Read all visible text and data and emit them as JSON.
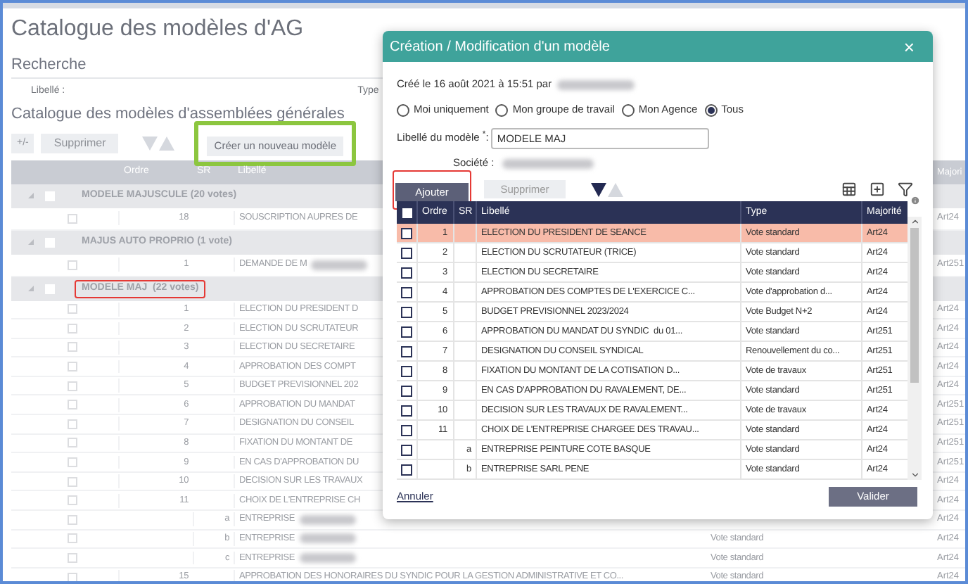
{
  "page": {
    "title": "Catalogue des modèles d'AG",
    "search_heading": "Recherche",
    "search_label": "Libellé :",
    "type_label": "Type",
    "catalog_heading": "Catalogue des modèles d'assemblées générales"
  },
  "toolbar": {
    "toggle": "+/-",
    "delete": "Supprimer",
    "create": {
      "label": "Créer un nouveau modèle",
      "annotated": true
    }
  },
  "catalog": {
    "columns": [
      "Ordre",
      "SR",
      "Libellé",
      "Majori"
    ],
    "groups": [
      {
        "label": "MODELE MAJUSCULE (20 votes)",
        "annotated": false,
        "checked": false,
        "rows": [
          {
            "ordre": "18",
            "libelle": "SOUSCRIPTION AUPRES DE",
            "majorite": "Art24",
            "checked": false
          }
        ]
      },
      {
        "label": "MAJUS AUTO PROPRIO (1 vote)",
        "annotated": false,
        "checked": false,
        "rows": [
          {
            "ordre": "1",
            "libelle": "DEMANDE DE M",
            "redacted": true,
            "majorite": "Art251",
            "checked": false
          }
        ]
      },
      {
        "label": "MODELE MAJ  (22 votes)",
        "annotated": true,
        "checked": false,
        "rows": [
          {
            "ordre": "1",
            "libelle": "ELECTION DU PRESIDENT D",
            "majorite": "Art24",
            "checked": false
          },
          {
            "ordre": "2",
            "libelle": "ELECTION DU SCRUTATEUR",
            "majorite": "Art24",
            "checked": false
          },
          {
            "ordre": "3",
            "libelle": "ELECTION DU SECRETAIRE",
            "majorite": "Art24",
            "checked": false
          },
          {
            "ordre": "4",
            "libelle": "APPROBATION DES COMPT",
            "majorite": "Art24",
            "checked": false
          },
          {
            "ordre": "5",
            "libelle": "BUDGET PREVISIONNEL 202",
            "majorite": "Art24",
            "checked": false
          },
          {
            "ordre": "6",
            "libelle": "APPROBATION DU MANDAT",
            "majorite": "Art251",
            "checked": false
          },
          {
            "ordre": "7",
            "libelle": "DESIGNATION DU CONSEIL",
            "majorite": "Art251",
            "checked": false
          },
          {
            "ordre": "8",
            "libelle": "FIXATION DU MONTANT DE",
            "majorite": "Art251",
            "checked": false
          },
          {
            "ordre": "9",
            "libelle": "EN CAS D'APPROBATION DU",
            "majorite": "Art251",
            "checked": false
          },
          {
            "ordre": "10",
            "libelle": "DECISION SUR LES TRAVAUX",
            "majorite": "Art24",
            "checked": false
          },
          {
            "ordre": "11",
            "libelle": "CHOIX DE L'ENTREPRISE CH",
            "majorite": "Art24",
            "checked": false
          },
          {
            "sr": "a",
            "libelle": "ENTREPRISE",
            "redacted": true,
            "majorite": "Art24",
            "checked": false
          },
          {
            "sr": "b",
            "libelle": "ENTREPRISE",
            "redacted": true,
            "type": "Vote standard",
            "majorite": "Art24",
            "checked": false
          },
          {
            "sr": "c",
            "libelle": "ENTREPRISE",
            "redacted": true,
            "type": "Vote standard",
            "majorite": "Art24",
            "checked": false
          },
          {
            "ordre": "15",
            "libelle": "APPROBATION DES HONORAIRES DU SYNDIC POUR LA GESTION ADMINISTRATIVE ET CO...",
            "type": "Vote standard",
            "majorite": "Art24",
            "checked": false
          }
        ]
      }
    ]
  },
  "dialog": {
    "title": "Création / Modification d'un modèle",
    "close": "×",
    "created": "Créé le 16 août 2021 à 15:51 par",
    "visibility": [
      {
        "label": "Moi uniquement",
        "selected": false
      },
      {
        "label": "Mon groupe de travail",
        "selected": false
      },
      {
        "label": "Mon Agence",
        "selected": false
      },
      {
        "label": "Tous",
        "selected": true
      }
    ],
    "name_label": "Libellé du modèle",
    "required_mark": "*",
    "name_suffix": ":",
    "name_value": "MODELE MAJ",
    "company_label": "Société :",
    "add": {
      "label": "Ajouter",
      "annotated": true
    },
    "delete": "Supprimer",
    "all_checked": false,
    "columns": [
      "Ordre",
      "SR",
      "Libellé",
      "Type",
      "Majorité"
    ],
    "rows": [
      {
        "ordre": "1",
        "libelle": "ELECTION DU PRESIDENT DE SEANCE",
        "type": "Vote standard",
        "majorite": "Art24",
        "selected": true,
        "checked": false
      },
      {
        "ordre": "2",
        "libelle": "ELECTION DU SCRUTATEUR (TRICE)",
        "type": "Vote standard",
        "majorite": "Art24",
        "selected": false,
        "checked": false
      },
      {
        "ordre": "3",
        "libelle": "ELECTION DU SECRETAIRE",
        "type": "Vote standard",
        "majorite": "Art24",
        "selected": false,
        "checked": false
      },
      {
        "ordre": "4",
        "libelle": "APPROBATION DES COMPTES DE L'EXERCICE C...",
        "type": "Vote d'approbation d...",
        "majorite": "Art24",
        "selected": false,
        "checked": false
      },
      {
        "ordre": "5",
        "libelle": "BUDGET PREVISIONNEL 2023/2024",
        "type": "Vote Budget N+2",
        "majorite": "Art24",
        "selected": false,
        "checked": false
      },
      {
        "ordre": "6",
        "libelle": "APPROBATION DU MANDAT DU SYNDIC  du 01...",
        "type": "Vote standard",
        "majorite": "Art251",
        "selected": false,
        "checked": false
      },
      {
        "ordre": "7",
        "libelle": "DESIGNATION DU CONSEIL SYNDICAL",
        "type": "Renouvellement du co...",
        "majorite": "Art251",
        "selected": false,
        "checked": false
      },
      {
        "ordre": "8",
        "libelle": "FIXATION DU MONTANT DE LA COTISATION D...",
        "type": "Vote de travaux",
        "majorite": "Art251",
        "selected": false,
        "checked": false
      },
      {
        "ordre": "9",
        "libelle": "EN CAS D'APPROBATION DU RAVALEMENT, DE...",
        "type": "Vote standard",
        "majorite": "Art251",
        "selected": false,
        "checked": false
      },
      {
        "ordre": "10",
        "libelle": "DECISION SUR LES TRAVAUX DE RAVALEMENT...",
        "type": "Vote de travaux",
        "majorite": "Art24",
        "selected": false,
        "checked": false
      },
      {
        "ordre": "11",
        "libelle": "CHOIX DE L'ENTREPRISE CHARGEE DES TRAVAU...",
        "type": "Vote standard",
        "majorite": "Art24",
        "selected": false,
        "checked": false
      },
      {
        "sr": "a",
        "libelle": "ENTREPRISE PEINTURE COTE BASQUE",
        "type": "Vote standard",
        "majorite": "Art24",
        "selected": false,
        "checked": false
      },
      {
        "sr": "b",
        "libelle": "ENTREPRISE SARL PENE",
        "type": "Vote standard",
        "majorite": "Art24",
        "selected": false,
        "checked": false
      }
    ],
    "cancel": "Annuler",
    "submit": "Valider"
  }
}
